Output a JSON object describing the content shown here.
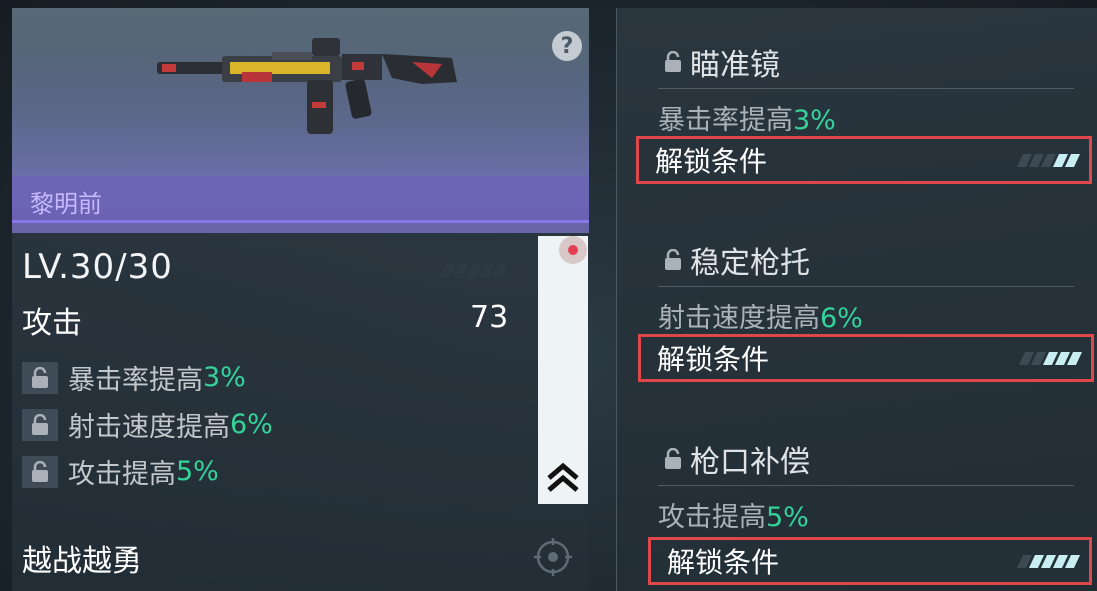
{
  "weapon": {
    "name": "黎明前",
    "help_icon": "?",
    "level": "LV.30/30",
    "attack_label": "攻击",
    "attack_value": "73",
    "perks": [
      {
        "text": "暴击率提高",
        "value": "3%"
      },
      {
        "text": "射击速度提高",
        "value": "6%"
      },
      {
        "text": "攻击提高",
        "value": "5%"
      }
    ],
    "skill_name": "越战越勇"
  },
  "attachments": [
    {
      "title": "瞄准镜",
      "desc": "暴击率提高",
      "value": "3%",
      "unlock_label": "解锁条件",
      "progress_filled": 2,
      "progress_total": 5
    },
    {
      "title": "稳定枪托",
      "desc": "射击速度提高",
      "value": "6%",
      "unlock_label": "解锁条件",
      "progress_filled": 3,
      "progress_total": 5
    },
    {
      "title": "枪口补偿",
      "desc": "攻击提高",
      "value": "5%",
      "unlock_label": "解锁条件",
      "progress_filled": 4,
      "progress_total": 5
    }
  ],
  "colors": {
    "accent_green": "#33d39a",
    "highlight_red": "#e0474b",
    "name_purple": "#c7b8ff"
  }
}
